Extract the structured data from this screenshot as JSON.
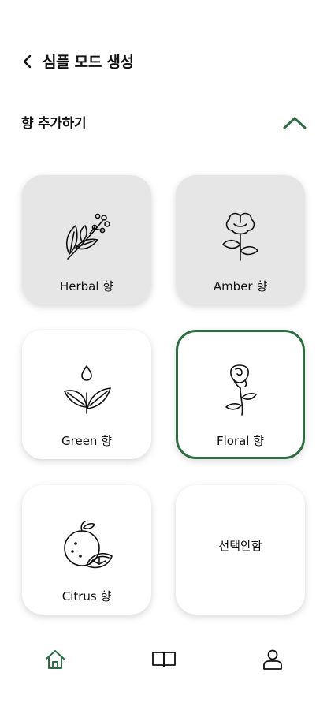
{
  "header": {
    "title": "심플 모드 생성",
    "back_icon": "chevron-left-icon"
  },
  "section": {
    "title": "향 추가하기",
    "toggle_icon": "chevron-up-icon",
    "accent_color": "#2f6b43"
  },
  "cards": [
    {
      "label": "Herbal 향",
      "icon": "herb-branch-icon",
      "state": "grey"
    },
    {
      "label": "Amber 향",
      "icon": "cotton-flower-icon",
      "state": "grey"
    },
    {
      "label": "Green 향",
      "icon": "sprout-drop-icon",
      "state": "normal"
    },
    {
      "label": "Floral 향",
      "icon": "rose-icon",
      "state": "selected"
    },
    {
      "label": "Citrus 향",
      "icon": "orange-icon",
      "state": "normal"
    },
    {
      "label": "선택안함",
      "icon": "",
      "state": "normal"
    }
  ],
  "bottom_nav": {
    "items": [
      {
        "icon": "home-icon",
        "active": true
      },
      {
        "icon": "book-icon",
        "active": false
      },
      {
        "icon": "user-icon",
        "active": false
      }
    ]
  }
}
